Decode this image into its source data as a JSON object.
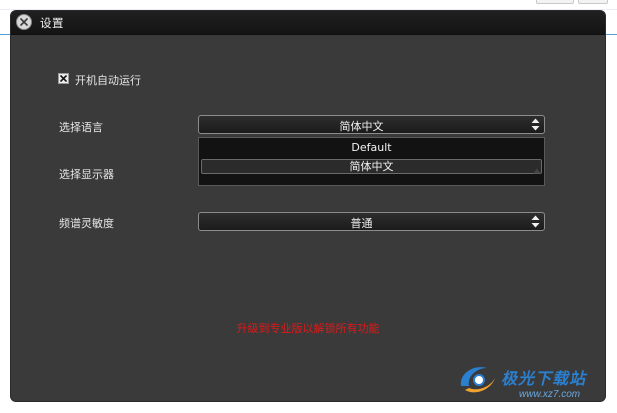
{
  "window": {
    "title": "设置"
  },
  "settings": {
    "autostart": {
      "label": "开机自动运行",
      "checked": true
    },
    "language": {
      "label": "选择语言",
      "value": "简体中文",
      "options": [
        "Default",
        "简体中文"
      ]
    },
    "display": {
      "label": "选择显示器"
    },
    "sensitivity": {
      "label": "频谱灵敏度",
      "value": "普通"
    }
  },
  "upgrade_notice": "升级到专业版以解锁所有功能",
  "watermark": {
    "text": "极光下载站",
    "url": "www.xz7.com"
  },
  "colors": {
    "accent_red": "#e01818",
    "window_bg": "#3a3a3a",
    "watermark_blue": "#2b7fcf"
  },
  "icons": {
    "close": "close-icon",
    "checkbox": "checkmark-x-icon",
    "combo": "updown-arrows-icon"
  }
}
